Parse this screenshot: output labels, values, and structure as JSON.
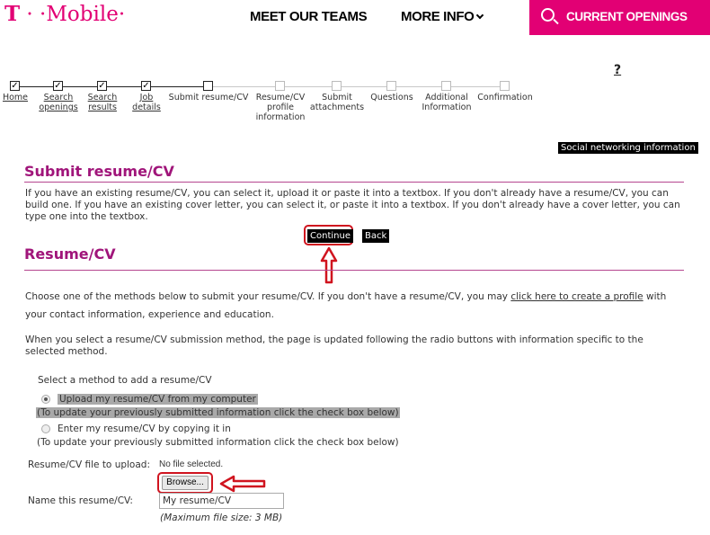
{
  "header": {
    "logo_t": "T",
    "logo_rest": " · ·Mobile·",
    "nav": [
      {
        "label": "MEET OUR TEAMS"
      },
      {
        "label": "MORE INFO"
      }
    ],
    "openings_label": "CURRENT OPENINGS",
    "brand_color": "#e20074"
  },
  "steps": [
    {
      "label": "Home",
      "checked": true,
      "link": true
    },
    {
      "label": "Search\nopenings",
      "checked": true,
      "link": true
    },
    {
      "label": "Search\nresults",
      "checked": true,
      "link": true
    },
    {
      "label": "Job\ndetails",
      "checked": true,
      "link": true
    },
    {
      "label": "Submit resume/CV",
      "checked": false,
      "current": true
    },
    {
      "label": "Resume/CV\nprofile\ninformation",
      "checked": false
    },
    {
      "label": "Submit\nattachments",
      "checked": false
    },
    {
      "label": "Questions",
      "checked": false
    },
    {
      "label": "Additional\nInformation",
      "checked": false
    },
    {
      "label": "Confirmation",
      "checked": false
    }
  ],
  "help_label": "?",
  "social_label": "Social networking information",
  "submit_section": {
    "title": "Submit resume/CV",
    "description": "If you have an existing resume/CV, you can select it, upload it or paste it into a textbox. If you don't already have a resume/CV, you can build one. If you have an existing cover letter, you can select it, or paste it into a textbox. If you don't already have a cover letter, you can type one into the textbox.",
    "continue_label": "Continue",
    "back_label": "Back"
  },
  "resume_section": {
    "title": "Resume/CV",
    "intro_before_link": "Choose one of the methods below to submit your resume/CV. If you don't have a resume/CV, you may ",
    "intro_link": "click here to create a profile",
    "intro_after_link": " with your contact information, experience and education.",
    "update_note": "When you select a resume/CV submission method, the page is updated following the radio buttons with information specific to the selected method.",
    "method_label": "Select a method to add a resume/CV",
    "methods": [
      {
        "label": "Upload my resume/CV from my computer",
        "note": "(To update your previously submitted information click the check box below)",
        "selected": true
      },
      {
        "label": "Enter my resume/CV by copying it in",
        "note": "(To update your previously submitted information click the check box below)",
        "selected": false
      }
    ],
    "file_label": "Resume/CV file to upload:",
    "file_status": "No file selected.",
    "browse_label": "Browse...",
    "name_label": "Name this resume/CV:",
    "name_value": "My resume/CV",
    "max_size_note": "(Maximum file size: 3 MB)"
  }
}
